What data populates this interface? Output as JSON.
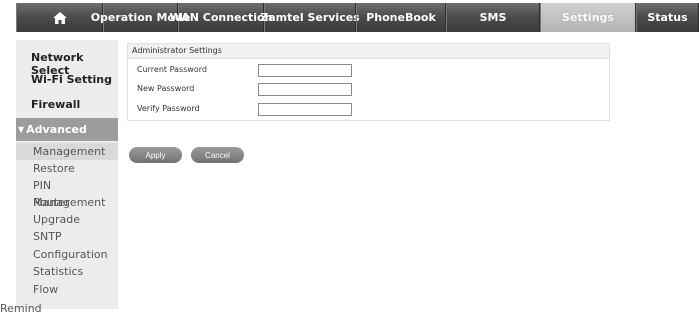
{
  "nav": {
    "home_icon": "home-icon",
    "items": [
      {
        "label": "Operation Mode"
      },
      {
        "label": "WAN Connection"
      },
      {
        "label": "Zamtel Services"
      },
      {
        "label": "PhoneBook"
      },
      {
        "label": "SMS"
      },
      {
        "label": "Settings"
      },
      {
        "label": "Status"
      }
    ],
    "active": "Settings"
  },
  "sidebar": {
    "items": [
      {
        "label": "Network Select"
      },
      {
        "label": "Wi-Fi Setting"
      },
      {
        "label": "Firewall"
      }
    ],
    "advanced": {
      "label": "Advanced",
      "expanded_icon": "triangle-down-icon"
    },
    "sub_items": [
      {
        "label": "Management"
      },
      {
        "label": "Restore"
      },
      {
        "label": "PIN Management"
      },
      {
        "label": "Router"
      },
      {
        "label": "Upgrade"
      },
      {
        "label": "SNTP"
      },
      {
        "label": "Configuration"
      },
      {
        "label": "Statistics"
      },
      {
        "label": "Flow"
      },
      {
        "label": "Remind"
      }
    ],
    "active_sub_item": "Management"
  },
  "panel": {
    "title": "Administrator Settings",
    "fields": [
      {
        "label": "Current Password",
        "value": ""
      },
      {
        "label": "New Password",
        "value": ""
      },
      {
        "label": "Verify Password",
        "value": ""
      }
    ]
  },
  "actions": {
    "apply": "Apply",
    "cancel": "Cancel"
  },
  "colors": {
    "nav_bar": "#4a4a4a",
    "nav_active": "#bdbdbd",
    "sidebar_bg": "#ececec",
    "advanced_bg": "#9c9c9c",
    "button_bg": "#808080"
  }
}
